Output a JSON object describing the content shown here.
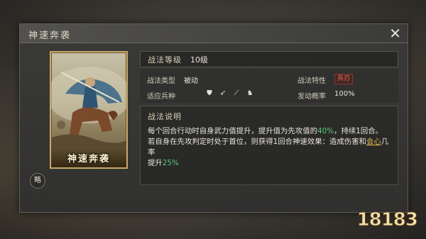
{
  "dialog": {
    "title": "神速奔袭",
    "close_icon": "close-icon"
  },
  "card": {
    "name": "神速奔袭"
  },
  "brief_button": "略",
  "level": {
    "label": "战法等级",
    "value": "10级"
  },
  "attrs": {
    "type_label": "战法类型",
    "type_value": "被动",
    "trait_label": "战法特性",
    "trait_value": "兵刃",
    "troops_label": "适应兵种",
    "troop_icons": [
      "shield-icon",
      "bow-icon",
      "spear-icon",
      "horse-icon"
    ],
    "rate_label": "发动概率",
    "rate_value": "100%"
  },
  "description": {
    "header": "战法说明",
    "line1_a": "每个回合行动时自身武力值提升，提升值为先攻值的",
    "line1_pct": "40%",
    "line1_b": "，持续1回合。",
    "line2_a": "若自身在先攻判定时处于首位，则获得1回合神速效果：造成伤害和",
    "line2_link": "会心",
    "line2_b": "几率",
    "line3_a": "提升",
    "line3_pct": "25%"
  },
  "watermark": "18183",
  "colors": {
    "highlight_green": "#58c878",
    "highlight_gold": "#e3b94a",
    "trait_red": "#ff6a5a",
    "card_border": "#c9a86a"
  }
}
